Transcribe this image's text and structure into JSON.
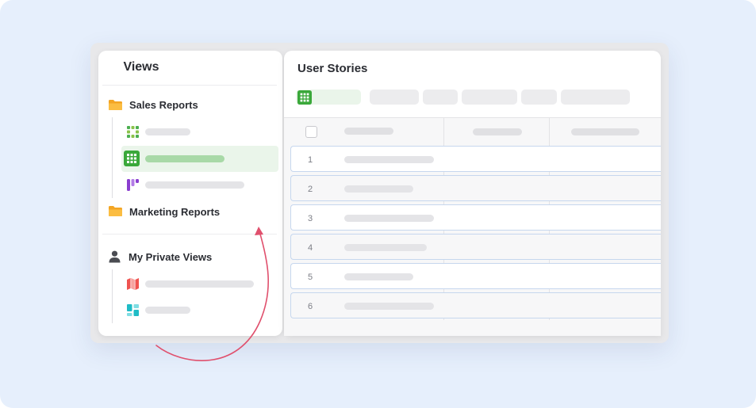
{
  "views_panel": {
    "title": "Views",
    "groups": [
      {
        "label": "Sales Reports",
        "icon": "folder-icon",
        "items": [
          "grid-dots-icon",
          "grid-view-icon",
          "kanban-icon"
        ],
        "active_item": 1
      },
      {
        "label": "Marketing Reports",
        "icon": "folder-icon"
      },
      {
        "label": "My Private Views",
        "icon": "person-icon",
        "items": [
          "map-icon",
          "gallery-icon"
        ]
      }
    ]
  },
  "stories_panel": {
    "title": "User Stories",
    "active_view_icon": "grid-view-icon",
    "rows": [
      "1",
      "2",
      "3",
      "4",
      "5",
      "6"
    ]
  },
  "colors": {
    "background": "#e6effc",
    "folder": "#f5a623",
    "active_green": "#3aa83a",
    "kanban_purple": "#8a3ecf",
    "map_red": "#ef5350",
    "gallery_teal": "#1fbcc6",
    "arrow": "#e0506d"
  }
}
